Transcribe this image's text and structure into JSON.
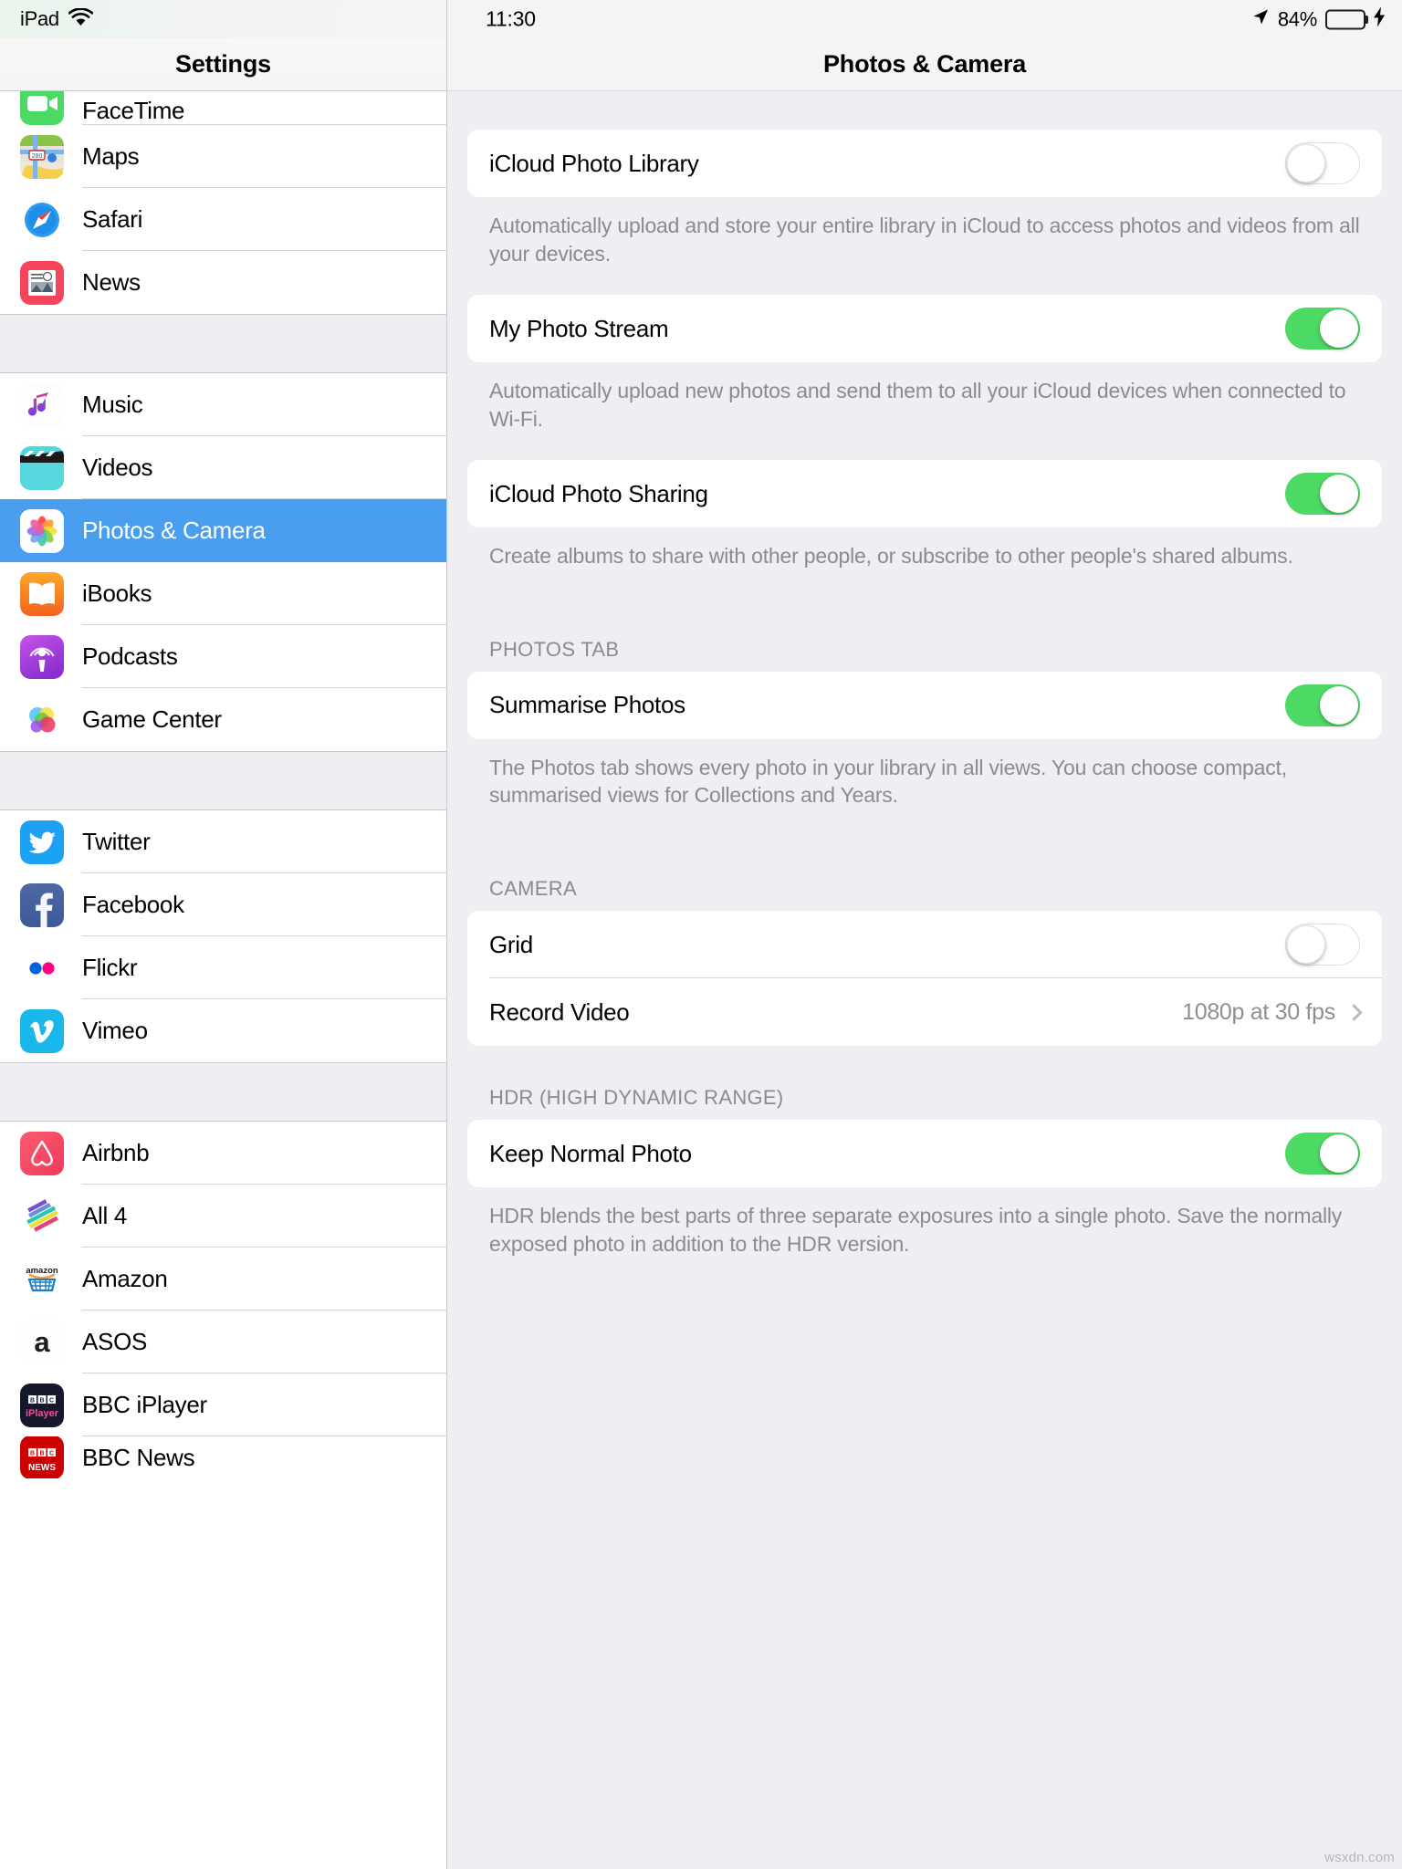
{
  "status_bar": {
    "device_label": "iPad",
    "wifi_icon": "wifi-icon",
    "time": "11:30",
    "location_icon": "location-arrow-icon",
    "battery_percent": "84%",
    "battery_level": 84,
    "charging_icon": "lightning-bolt-icon"
  },
  "sidebar": {
    "title": "Settings",
    "selected_item": "Photos & Camera",
    "selection_color": "#4a9ef0",
    "groups": [
      {
        "items": [
          {
            "label": "FaceTime",
            "icon": "facetime-icon",
            "clipped": true
          },
          {
            "label": "Maps",
            "icon": "maps-icon"
          },
          {
            "label": "Safari",
            "icon": "safari-icon"
          },
          {
            "label": "News",
            "icon": "news-icon"
          }
        ]
      },
      {
        "items": [
          {
            "label": "Music",
            "icon": "music-icon"
          },
          {
            "label": "Videos",
            "icon": "videos-icon"
          },
          {
            "label": "Photos & Camera",
            "icon": "photos-icon",
            "selected": true
          },
          {
            "label": "iBooks",
            "icon": "ibooks-icon"
          },
          {
            "label": "Podcasts",
            "icon": "podcasts-icon"
          },
          {
            "label": "Game Center",
            "icon": "gamecenter-icon"
          }
        ]
      },
      {
        "items": [
          {
            "label": "Twitter",
            "icon": "twitter-icon"
          },
          {
            "label": "Facebook",
            "icon": "facebook-icon"
          },
          {
            "label": "Flickr",
            "icon": "flickr-icon"
          },
          {
            "label": "Vimeo",
            "icon": "vimeo-icon"
          }
        ]
      },
      {
        "items": [
          {
            "label": "Airbnb",
            "icon": "airbnb-icon"
          },
          {
            "label": "All 4",
            "icon": "all4-icon"
          },
          {
            "label": "Amazon",
            "icon": "amazon-icon"
          },
          {
            "label": "ASOS",
            "icon": "asos-icon"
          },
          {
            "label": "BBC iPlayer",
            "icon": "bbciplayer-icon"
          },
          {
            "label": "BBC News",
            "icon": "bbcnews-icon",
            "clipped": true
          }
        ]
      }
    ]
  },
  "detail": {
    "title": "Photos & Camera",
    "sections": [
      {
        "rows": [
          {
            "label": "iCloud Photo Library",
            "control": "toggle",
            "state": "off"
          }
        ],
        "footnote": "Automatically upload and store your entire library in iCloud to access photos and videos from all your devices."
      },
      {
        "rows": [
          {
            "label": "My Photo Stream",
            "control": "toggle",
            "state": "on"
          }
        ],
        "footnote": "Automatically upload new photos and send them to all your iCloud devices when connected to Wi-Fi."
      },
      {
        "rows": [
          {
            "label": "iCloud Photo Sharing",
            "control": "toggle",
            "state": "on"
          }
        ],
        "footnote": "Create albums to share with other people, or subscribe to other people's shared albums."
      },
      {
        "header": "PHOTOS TAB",
        "rows": [
          {
            "label": "Summarise Photos",
            "control": "toggle",
            "state": "on"
          }
        ],
        "footnote": "The Photos tab shows every photo in your library in all views. You can choose compact, summarised views for Collections and Years."
      },
      {
        "header": "CAMERA",
        "rows": [
          {
            "label": "Grid",
            "control": "toggle",
            "state": "off"
          },
          {
            "label": "Record Video",
            "control": "disclosure",
            "value": "1080p at 30 fps"
          }
        ]
      },
      {
        "header": "HDR (HIGH DYNAMIC RANGE)",
        "rows": [
          {
            "label": "Keep Normal Photo",
            "control": "toggle",
            "state": "on"
          }
        ],
        "footnote": "HDR blends the best parts of three separate exposures into a single photo. Save the normally exposed photo in addition to the HDR version."
      }
    ]
  },
  "watermark": "wsxdn.com",
  "colors": {
    "toggle_on": "#4cd964",
    "accent_blue": "#4a9ef0",
    "panel_bg": "#eeeef3",
    "card_bg": "#ffffff",
    "muted_text": "#8a8a90"
  }
}
